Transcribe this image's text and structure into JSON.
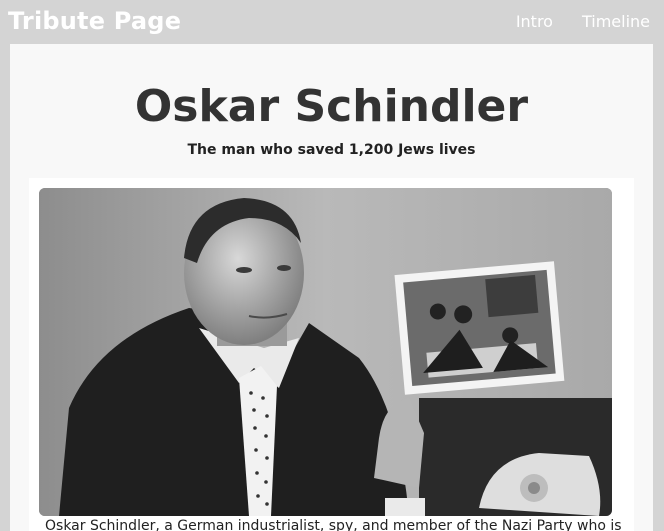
{
  "navbar": {
    "brand": "Tribute Page",
    "links": [
      "Intro",
      "Timeline"
    ]
  },
  "main": {
    "title": "Oskar Schindler",
    "subtitle": "The man who saved 1,200 Jews lives",
    "caption": "Oskar Schindler, a German industrialist, spy, and member of the Nazi Party who is"
  },
  "photo": {
    "icon": "portrait-photo"
  }
}
